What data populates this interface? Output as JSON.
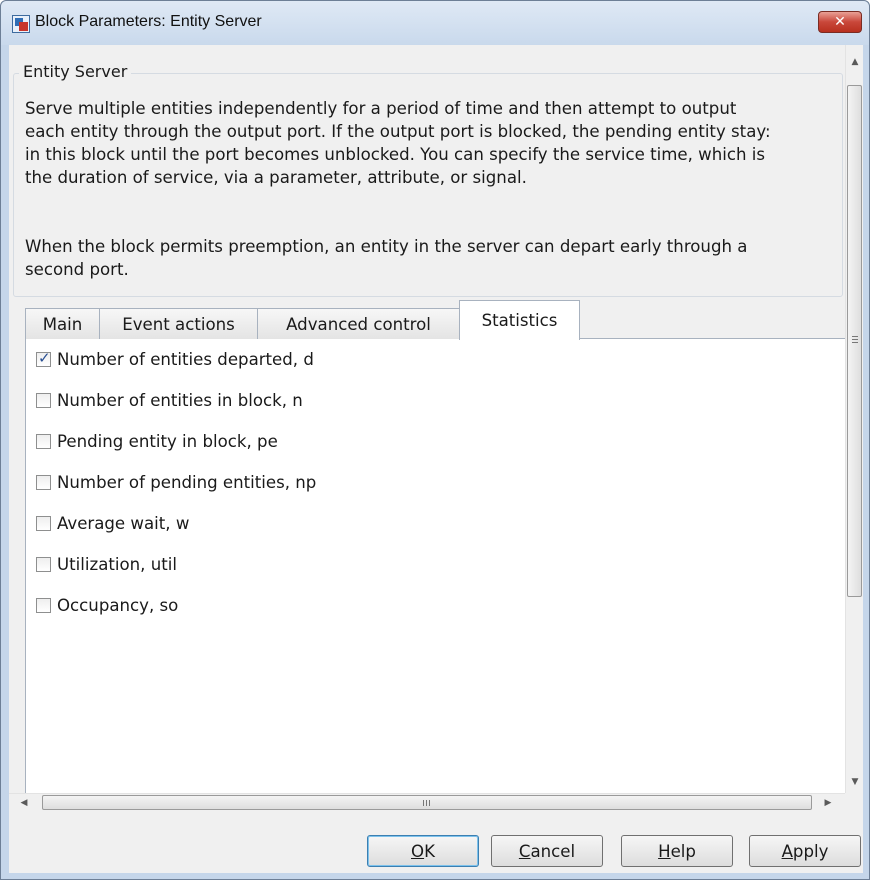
{
  "window": {
    "title": "Block Parameters: Entity Server",
    "close_icon": "close-icon",
    "app_icon": "simulink-block-icon"
  },
  "group": {
    "title": "Entity Server",
    "description_lines": [
      "Serve multiple entities independently for a period of time and then attempt to output",
      "each entity through the output port. If the output port is blocked, the pending entity stay:",
      "in this block until the port becomes unblocked. You can specify the service time, which is",
      "the duration of service, via a parameter, attribute, or signal."
    ],
    "description2_lines": [
      "When the block permits preemption, an entity in the server can depart early through a",
      "second port."
    ]
  },
  "tabs": [
    {
      "label": "Main",
      "active": false
    },
    {
      "label": "Event actions",
      "active": false
    },
    {
      "label": "Advanced control",
      "active": false
    },
    {
      "label": "Statistics",
      "active": true
    }
  ],
  "statistics": [
    {
      "label": "Number of entities departed, d",
      "checked": true
    },
    {
      "label": "Number of entities in block, n",
      "checked": false
    },
    {
      "label": "Pending entity in block, pe",
      "checked": false
    },
    {
      "label": "Number of pending entities, np",
      "checked": false
    },
    {
      "label": "Average wait, w",
      "checked": false
    },
    {
      "label": "Utilization, util",
      "checked": false
    },
    {
      "label": "Occupancy, so",
      "checked": false
    }
  ],
  "scrollbars": {
    "up_icon": "scroll-up-arrow-icon",
    "down_icon": "scroll-down-arrow-icon",
    "left_icon": "scroll-left-arrow-icon",
    "right_icon": "scroll-right-arrow-icon",
    "h_grip": "III"
  },
  "buttons": {
    "ok": {
      "mnemonic": "O",
      "rest": "K"
    },
    "cancel": {
      "mnemonic": "C",
      "rest": "ancel"
    },
    "help": {
      "mnemonic": "H",
      "rest": "elp"
    },
    "apply": {
      "mnemonic": "A",
      "rest": "pply"
    }
  },
  "colors": {
    "window_frame": "#c5d6ea",
    "close_button": "#c9473a",
    "checkmark": "#2a4f92",
    "default_button_border": "#3c7fb1"
  }
}
